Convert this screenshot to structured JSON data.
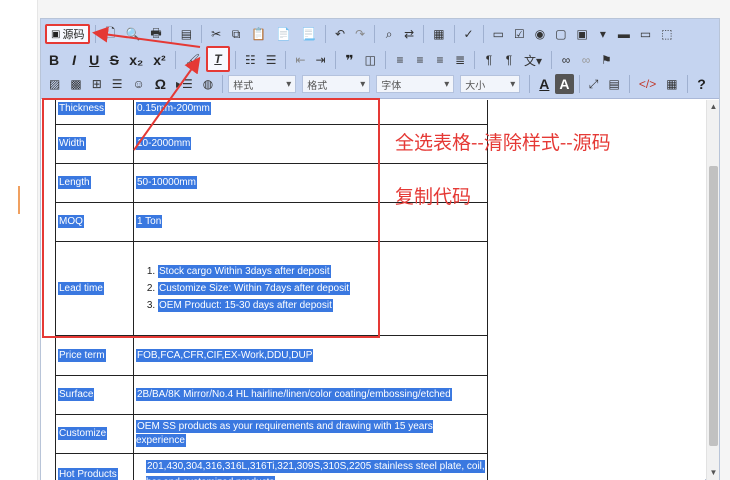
{
  "toolbar": {
    "source_label": "源码",
    "row1_icons": [
      "new-page-icon",
      "preview-icon",
      "print-icon",
      "templates-icon",
      "cut-icon",
      "copy-icon",
      "paste-icon",
      "paste-text-icon",
      "paste-word-icon",
      "undo-icon",
      "redo-icon",
      "find-icon",
      "replace-icon",
      "select-all-icon",
      "spellcheck-icon",
      "form-icon",
      "checkbox-icon",
      "radio-icon",
      "textfield-icon",
      "textarea-icon",
      "select-icon",
      "button-icon",
      "imagebutton-icon",
      "hiddenfield-icon"
    ],
    "row2_buttons": [
      "B",
      "I",
      "U",
      "S",
      "x₂",
      "x²"
    ],
    "row2_icons": [
      "copy-format-icon",
      "remove-format-icon",
      "numbered-list-icon",
      "bulleted-list-icon",
      "outdent-icon",
      "indent-icon",
      "blockquote-icon",
      "div-icon",
      "align-left-icon",
      "align-center-icon",
      "align-right-icon",
      "justify-icon",
      "ltr-icon",
      "rtl-icon",
      "language-icon",
      "link-icon",
      "unlink-icon",
      "anchor-icon"
    ],
    "row3_icons": [
      "image-icon",
      "flash-icon",
      "table-icon",
      "horizontal-rule-icon",
      "smiley-icon",
      "special-char-icon",
      "page-break-icon",
      "iframe-icon"
    ],
    "combo_styles": "样式",
    "combo_format": "格式",
    "combo_font": "字体",
    "combo_size": "大小",
    "row3_tail_icons": [
      "text-color-icon",
      "background-color-icon",
      "maximize-icon",
      "show-blocks-icon",
      "html-code-icon",
      "preview-icon",
      "help-icon"
    ],
    "row3_tail_labels": [
      "A",
      "A",
      "?"
    ]
  },
  "table": {
    "rows": [
      {
        "key": "Thickness",
        "value": "0.15mm-200mm"
      },
      {
        "key": "Width",
        "value": "10-2000mm"
      },
      {
        "key": "Length",
        "value": "50-10000mm"
      },
      {
        "key": "MOQ",
        "value": "1 Ton"
      },
      {
        "key": "Lead time",
        "value": "",
        "list": [
          "Stock cargo Within 3days after deposit",
          "Customize Size: Within 7days after deposit ",
          "OEM Product: 15-30  days after deposit "
        ]
      },
      {
        "key": "Price term",
        "value": "FOB,FCA,CFR,CIF,EX-Work,DDU,DUP"
      },
      {
        "key": "Surface",
        "value": "2B/BA/8K Mirror/No.4 HL hairline/linen/color coating/embossing/etched"
      },
      {
        "key": "Customize",
        "value": "OEM SS products as your requirements and drawing with 15 years experience"
      },
      {
        "key": "Hot Products",
        "value": "201,430,304,316,316L,316Ti,321,309S,310S,2205 stainless steel plate, coil, bar and customized products"
      }
    ]
  },
  "annotations": {
    "line1": "全选表格--清除样式--源码",
    "line2": "复制代码"
  },
  "colors": {
    "selection": "#3a78e0",
    "annotation_red": "#e53935",
    "toolbar_bg": "#c5d4f0"
  }
}
